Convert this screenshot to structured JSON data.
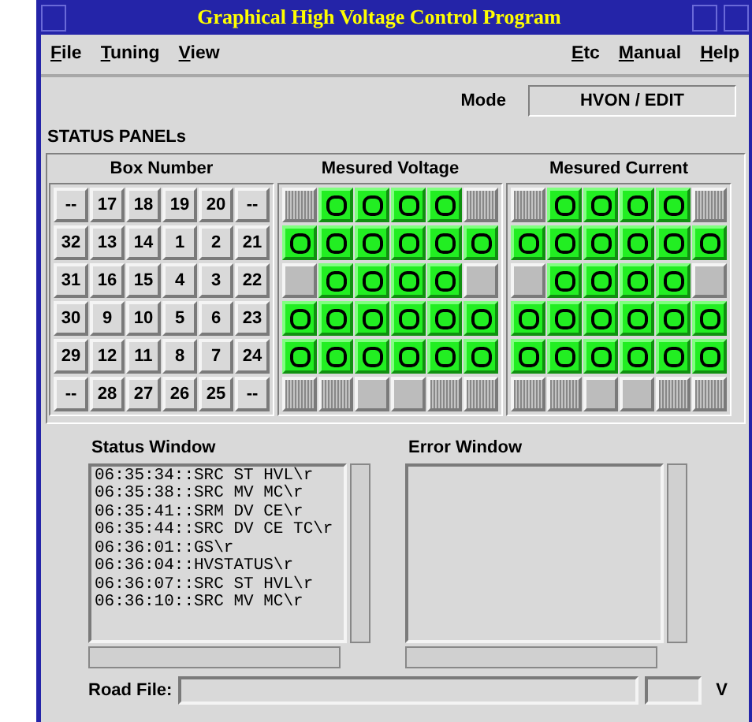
{
  "window": {
    "title": "Graphical High Voltage Control Program"
  },
  "menu_left": [
    "File",
    "Tuning",
    "View"
  ],
  "menu_right": [
    "Etc",
    "Manual",
    "Help"
  ],
  "mode": {
    "label": "Mode",
    "value": "HVON / EDIT"
  },
  "section_title": "STATUS PANELs",
  "box_number": {
    "title": "Box Number",
    "rows": [
      [
        "--",
        "17",
        "18",
        "19",
        "20",
        "--"
      ],
      [
        "32",
        "13",
        "14",
        "1",
        "2",
        "21"
      ],
      [
        "31",
        "16",
        "15",
        "4",
        "3",
        "22"
      ],
      [
        "30",
        "9",
        "10",
        "5",
        "6",
        "23"
      ],
      [
        "29",
        "12",
        "11",
        "8",
        "7",
        "24"
      ],
      [
        "--",
        "28",
        "27",
        "26",
        "25",
        "--"
      ]
    ]
  },
  "measured_voltage": {
    "title": "Mesured Voltage",
    "rows": [
      [
        {
          "kind": "blank"
        },
        {
          "kind": "on"
        },
        {
          "kind": "on"
        },
        {
          "kind": "on"
        },
        {
          "kind": "on"
        },
        {
          "kind": "blank"
        }
      ],
      [
        {
          "kind": "on"
        },
        {
          "kind": "on"
        },
        {
          "kind": "on"
        },
        {
          "kind": "on"
        },
        {
          "kind": "on"
        },
        {
          "kind": "on"
        }
      ],
      [
        {
          "kind": "off"
        },
        {
          "kind": "on"
        },
        {
          "kind": "on"
        },
        {
          "kind": "on"
        },
        {
          "kind": "on"
        },
        {
          "kind": "off"
        }
      ],
      [
        {
          "kind": "on"
        },
        {
          "kind": "on"
        },
        {
          "kind": "on"
        },
        {
          "kind": "on"
        },
        {
          "kind": "on"
        },
        {
          "kind": "on"
        }
      ],
      [
        {
          "kind": "on"
        },
        {
          "kind": "on"
        },
        {
          "kind": "on"
        },
        {
          "kind": "on"
        },
        {
          "kind": "on"
        },
        {
          "kind": "on"
        }
      ],
      [
        {
          "kind": "blank"
        },
        {
          "kind": "blank"
        },
        {
          "kind": "off"
        },
        {
          "kind": "off"
        },
        {
          "kind": "blank"
        },
        {
          "kind": "blank"
        }
      ]
    ]
  },
  "measured_current": {
    "title": "Mesured Current",
    "rows": [
      [
        {
          "kind": "blank"
        },
        {
          "kind": "on"
        },
        {
          "kind": "on"
        },
        {
          "kind": "on"
        },
        {
          "kind": "on"
        },
        {
          "kind": "blank"
        }
      ],
      [
        {
          "kind": "on"
        },
        {
          "kind": "on"
        },
        {
          "kind": "on"
        },
        {
          "kind": "on"
        },
        {
          "kind": "on"
        },
        {
          "kind": "on"
        }
      ],
      [
        {
          "kind": "off"
        },
        {
          "kind": "on"
        },
        {
          "kind": "on"
        },
        {
          "kind": "on"
        },
        {
          "kind": "on"
        },
        {
          "kind": "off"
        }
      ],
      [
        {
          "kind": "on"
        },
        {
          "kind": "on"
        },
        {
          "kind": "on"
        },
        {
          "kind": "on"
        },
        {
          "kind": "on"
        },
        {
          "kind": "on"
        }
      ],
      [
        {
          "kind": "on"
        },
        {
          "kind": "on"
        },
        {
          "kind": "on"
        },
        {
          "kind": "on"
        },
        {
          "kind": "on"
        },
        {
          "kind": "on"
        }
      ],
      [
        {
          "kind": "blank"
        },
        {
          "kind": "blank"
        },
        {
          "kind": "off"
        },
        {
          "kind": "off"
        },
        {
          "kind": "blank"
        },
        {
          "kind": "blank"
        }
      ]
    ]
  },
  "status_window": {
    "title": "Status Window",
    "lines": [
      "06:35:34::SRC ST HVL\\r",
      "06:35:38::SRC MV MC\\r",
      "06:35:41::SRM DV CE\\r",
      "06:35:44::SRC DV CE TC\\r",
      "06:36:01::GS\\r",
      "06:36:04::HVSTATUS\\r",
      "06:36:07::SRC ST HVL\\r",
      "06:36:10::SRC MV MC\\r"
    ]
  },
  "error_window": {
    "title": "Error Window"
  },
  "road_file": {
    "label": "Road File:",
    "unit": "V"
  }
}
